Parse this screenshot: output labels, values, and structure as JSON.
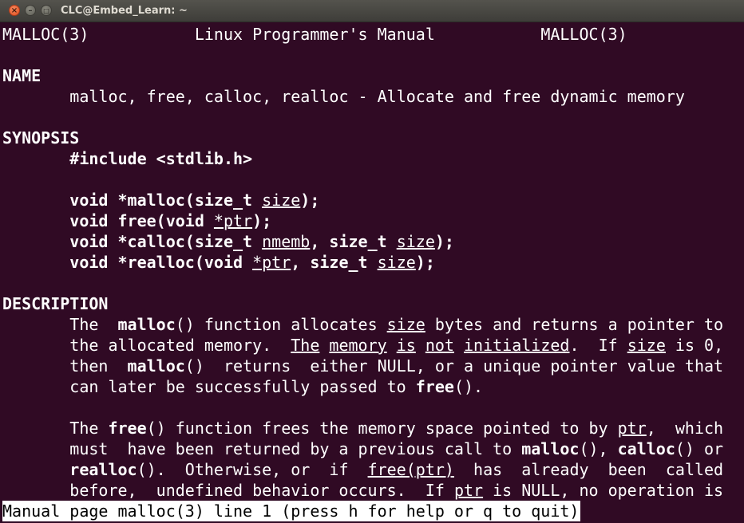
{
  "window": {
    "title": "CLC@Embed_Learn: ~"
  },
  "man": {
    "header_left": "MALLOC(3)",
    "header_center": "Linux Programmer's Manual",
    "header_right": "MALLOC(3)",
    "name_heading": "NAME",
    "name_text": "malloc, free, calloc, realloc - Allocate and free dynamic memory",
    "synopsis_heading": "SYNOPSIS",
    "include_line": "#include <stdlib.h>",
    "desc_heading": "DESCRIPTION"
  },
  "status": {
    "text": "Manual page malloc(3) line 1 (press h for help or q to quit)"
  },
  "colors": {
    "terminal_bg": "#300a24",
    "text": "#ffffff",
    "titlebar": "#3e3d39",
    "close_button": "#e1501f"
  }
}
